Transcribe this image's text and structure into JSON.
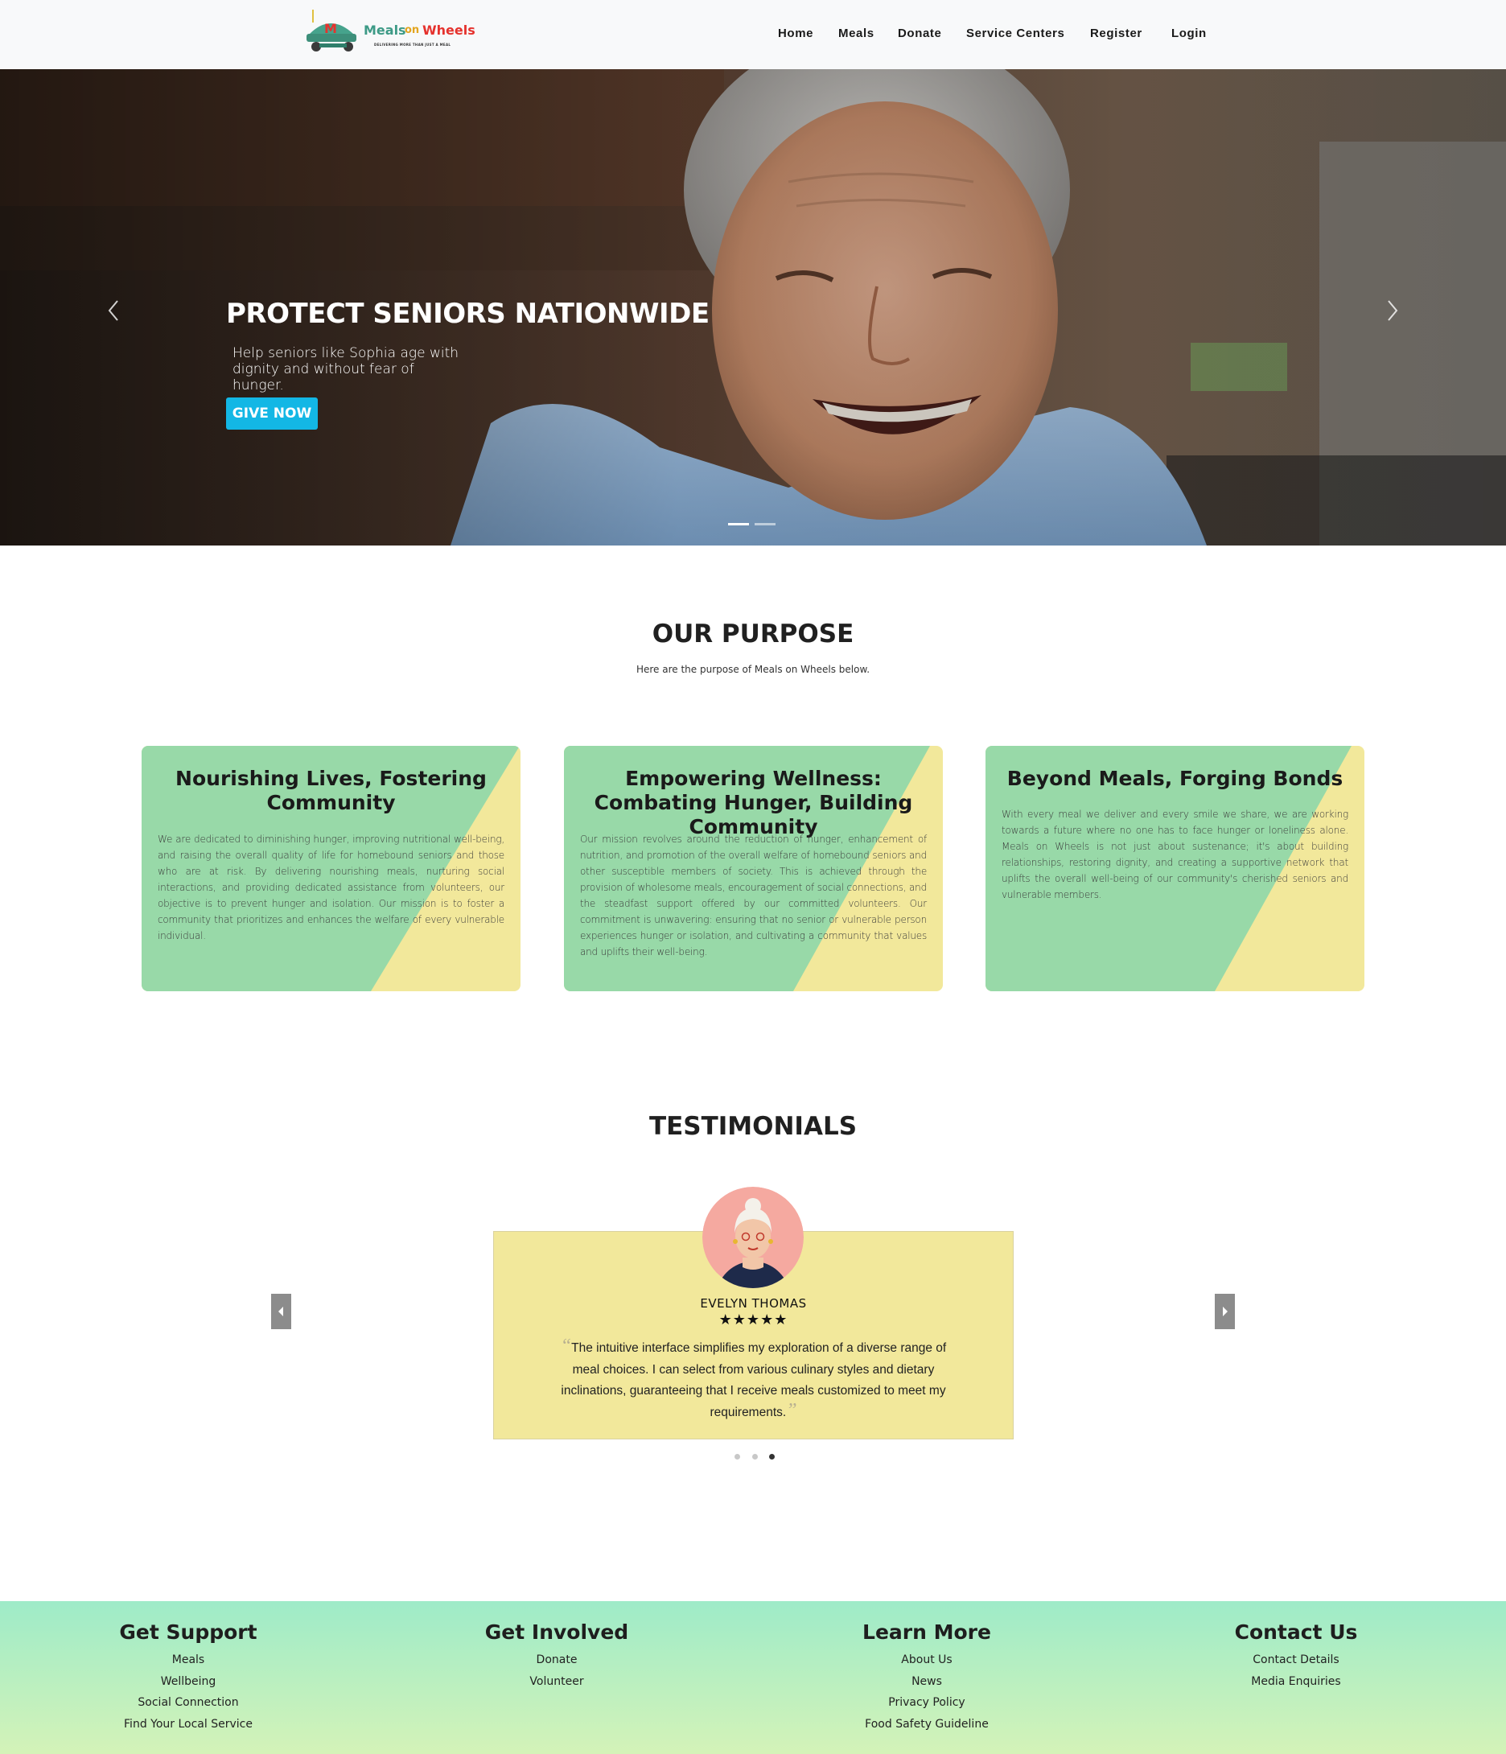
{
  "brand": {
    "name_part1": "Meals",
    "name_part2": "on",
    "name_part3": "Wheels",
    "tagline": "DELIVERING MORE THAN JUST A MEAL"
  },
  "nav": {
    "items": [
      {
        "label": "Home"
      },
      {
        "label": "Meals"
      },
      {
        "label": "Donate"
      },
      {
        "label": "Service Centers"
      },
      {
        "label": "Register"
      },
      {
        "label": "Login"
      }
    ]
  },
  "hero": {
    "title": "PROTECT SENIORS NATIONWIDE",
    "subtitle": "Help seniors like Sophia age with dignity and without fear of hunger.",
    "button": "GIVE NOW",
    "slides_count": 2,
    "active_slide": 1
  },
  "purpose": {
    "title": "OUR PURPOSE",
    "subtitle": "Here are the purpose of Meals on Wheels below.",
    "cards": [
      {
        "title": "Nourishing Lives, Fostering Community",
        "text": "We are dedicated to diminishing hunger, improving nutritional well-being, and raising the overall quality of life for homebound seniors and those who are at risk. By delivering nourishing meals, nurturing social interactions, and providing dedicated assistance from volunteers, our objective is to prevent hunger and isolation. Our mission is to foster a community that prioritizes and enhances the welfare of every vulnerable individual."
      },
      {
        "title": "Empowering Wellness: Combating Hunger, Building Community",
        "text": "Our mission revolves around the reduction of hunger, enhancement of nutrition, and promotion of the overall welfare of homebound seniors and other susceptible members of society. This is achieved through the provision of wholesome meals, encouragement of social connections, and the steadfast support offered by our committed volunteers. Our commitment is unwavering: ensuring that no senior or vulnerable person experiences hunger or isolation, and cultivating a community that values and uplifts their well-being."
      },
      {
        "title": "Beyond Meals, Forging Bonds",
        "text": "With every meal we deliver and every smile we share, we are working towards a future where no one has to face hunger or loneliness alone. Meals on Wheels is not just about sustenance; it's about building relationships, restoring dignity, and creating a supportive network that uplifts the overall well-being of our community's cherished seniors and vulnerable members."
      }
    ]
  },
  "testimonials": {
    "title": "TESTIMONIALS",
    "name": "EVELYN THOMAS",
    "stars": "★★★★★",
    "rating": 5,
    "quote": "The intuitive interface simplifies my exploration of a diverse range of meal choices. I can select from various culinary styles and dietary inclinations, guaranteeing that I receive meals customized to meet my requirements.",
    "open_quote": "“",
    "close_quote": "”",
    "dots_count": 3,
    "active_dot": 3
  },
  "footer": {
    "columns": [
      {
        "title": "Get Support",
        "links": [
          "Meals",
          "Wellbeing",
          "Social Connection",
          "Find Your Local Service"
        ]
      },
      {
        "title": "Get Involved",
        "links": [
          "Donate",
          "Volunteer"
        ]
      },
      {
        "title": "Learn More",
        "links": [
          "About Us",
          "News",
          "Privacy Policy",
          "Food Safety Guideline"
        ]
      },
      {
        "title": "Contact Us",
        "links": [
          "Contact Details",
          "Media Enquiries"
        ]
      }
    ]
  },
  "colors": {
    "accent": "#13b7e5",
    "card_green": "#98d9a8",
    "card_yellow": "#f2e89b",
    "footer_top": "#9eebc8",
    "footer_bottom": "#d4f3b8"
  }
}
